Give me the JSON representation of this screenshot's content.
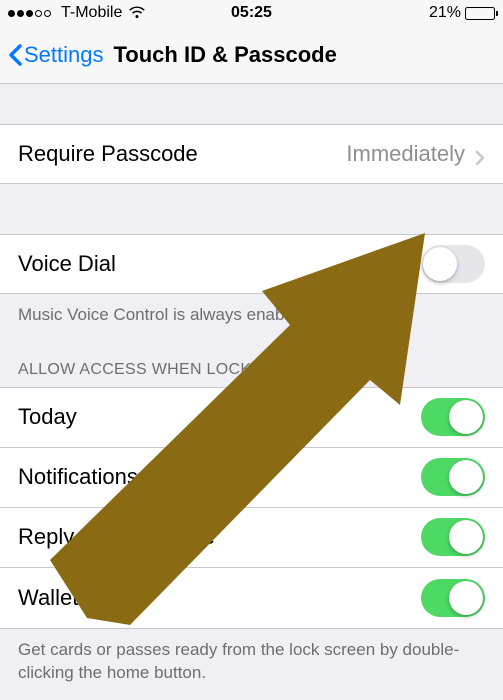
{
  "status_bar": {
    "carrier": "T-Mobile",
    "time": "05:25",
    "battery_percent": "21%",
    "battery_fill_pct": 21
  },
  "nav": {
    "back_label": "Settings",
    "title": "Touch ID & Passcode"
  },
  "require_passcode": {
    "label": "Require Passcode",
    "value": "Immediately"
  },
  "voice_dial": {
    "label": "Voice Dial",
    "on": false,
    "footer": "Music Voice Control is always enabled."
  },
  "allow_access_header": "ALLOW ACCESS WHEN LOCKED:",
  "access_items": [
    {
      "label": "Today",
      "on": true,
      "name": "toggle-today"
    },
    {
      "label": "Notifications View",
      "on": true,
      "name": "toggle-notifications-view"
    },
    {
      "label": "Reply with Message",
      "on": true,
      "name": "toggle-reply-with-message"
    },
    {
      "label": "Wallet",
      "on": true,
      "name": "toggle-wallet"
    }
  ],
  "wallet_footer": "Get cards or passes ready from the lock screen by double-clicking the home button.",
  "overlay": {
    "arrow_color": "#8a6b14"
  }
}
